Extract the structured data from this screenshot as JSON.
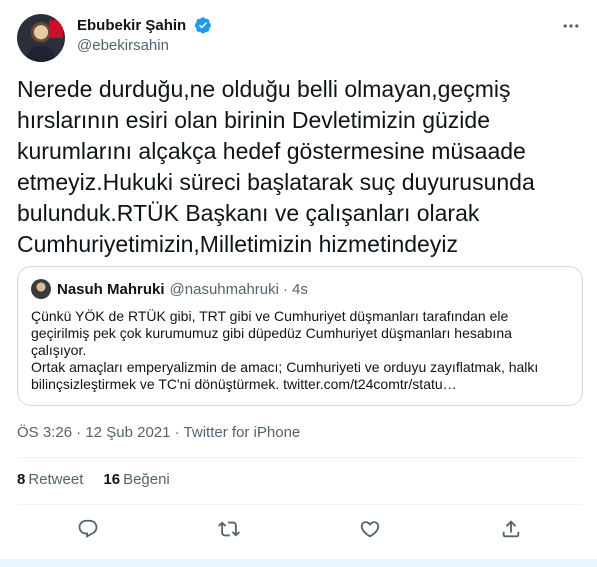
{
  "author": {
    "display_name": "Ebubekir Şahin",
    "handle": "@ebekirsahin",
    "verified": true
  },
  "tweet": {
    "text": "Nerede durduğu,ne olduğu belli olmayan,geçmiş hırslarının esiri olan birinin Devletimizin güzide kurumlarını alçakça hedef göstermesine müsaade etmeyiz.Hukuki süreci başlatarak suç duyurusunda bulunduk.RTÜK Başkanı ve çalışanları olarak Cumhuriyetimizin,Milletimizin hizmetindeyiz"
  },
  "quote": {
    "display_name": "Nasuh Mahruki",
    "handle": "@nasuhmahruki",
    "separator": "·",
    "time": "4s",
    "paragraph1": "Çünkü YÖK de RTÜK gibi, TRT gibi ve Cumhuriyet düşmanları tarafından ele geçirilmiş pek çok kurumumuz gibi düpedüz Cumhuriyet düşmanları hesabına çalışıyor.",
    "paragraph2": "Ortak amaçları emperyalizmin de amacı; Cumhuriyeti ve orduyu zayıflatmak, halkı bilinçsizleştirmek ve TC'ni dönüştürmek. twitter.com/t24comtr/statu…"
  },
  "meta": {
    "time": "ÖS 3:26",
    "sep1": " · ",
    "date": "12 Şub 2021",
    "sep2": " · ",
    "source": "Twitter for iPhone"
  },
  "stats": {
    "retweet_count": "8",
    "retweet_label": "Retweet",
    "like_count": "16",
    "like_label": "Beğeni"
  },
  "icons": {
    "verified": "verified-badge-icon",
    "more": "more-icon",
    "reply": "reply-icon",
    "retweet": "retweet-icon",
    "like": "heart-icon",
    "share": "share-icon"
  },
  "colors": {
    "text": "#0f1419",
    "secondary": "#536471",
    "accent": "#1d9bf0",
    "border": "#cfd9de"
  }
}
